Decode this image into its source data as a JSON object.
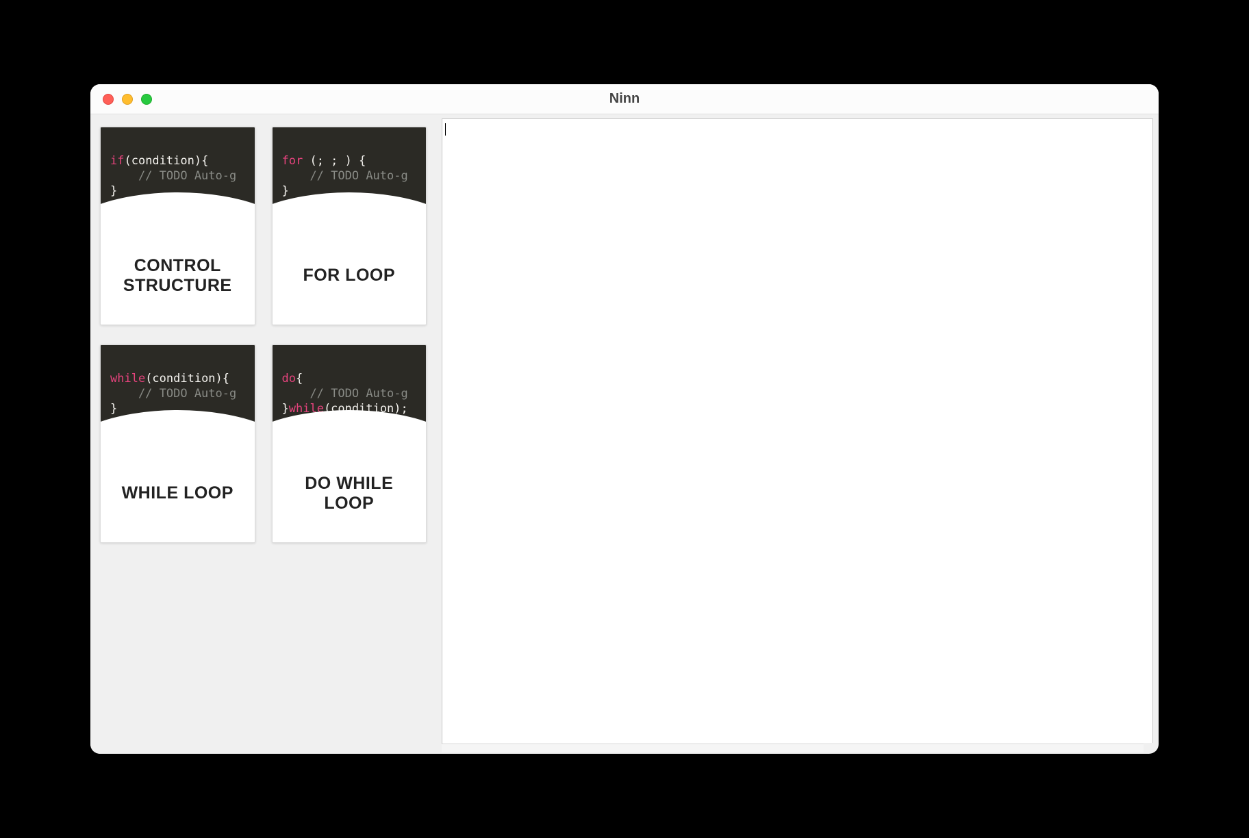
{
  "window": {
    "title": "Ninn"
  },
  "sidebar": {
    "cards": [
      {
        "id": "control-structure",
        "title": "CONTROL STRUCTURE",
        "code": {
          "line1_kw": "if",
          "line1_rest": "(condition){",
          "line2_comment": "    // TODO Auto-g",
          "line3": "}"
        }
      },
      {
        "id": "for-loop",
        "title": "FOR LOOP",
        "code": {
          "line1_kw": "for",
          "line1_rest": " (; ; ) {",
          "line2_comment": "    // TODO Auto-g",
          "line3": "}"
        }
      },
      {
        "id": "while-loop",
        "title": "WHILE LOOP",
        "code": {
          "line1_kw": "while",
          "line1_rest": "(condition){",
          "line2_comment": "    // TODO Auto-g",
          "line3": "}"
        }
      },
      {
        "id": "do-while-loop",
        "title": "DO WHILE LOOP",
        "code": {
          "line1_kw": "do",
          "line1_rest": "{",
          "line2_comment": "    // TODO Auto-g",
          "line3_pre": "}",
          "line3_kw": "while",
          "line3_rest": "(condition);"
        }
      }
    ]
  },
  "editor": {
    "content": ""
  }
}
